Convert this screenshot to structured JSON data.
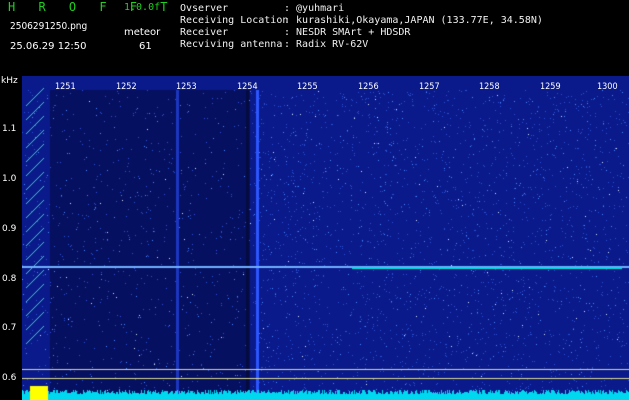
{
  "header": {
    "brand": "H R O F F T",
    "version": "1.0.0f",
    "filename": "2506291250.png",
    "datetime": "25.06.29 12:50",
    "meteor_label": "meteor",
    "meteor_count": "61"
  },
  "info": [
    {
      "key": "Ovserver",
      "value": ": @yuhmari"
    },
    {
      "key": "Receiving Location",
      "value": ": kurashiki,Okayama,JAPAN (133.77E, 34.58N)"
    },
    {
      "key": "Receiver",
      "value": ": NESDR SMArt + HDSDR"
    },
    {
      "key": "Recviving antenna",
      "value": ": Radix RV-62V"
    }
  ],
  "chart_data": {
    "type": "heatmap",
    "ylabel": "kHz",
    "y_ticks": [
      "1.1",
      "1.0",
      "0.9",
      "0.8",
      "0.7",
      "0.6"
    ],
    "x_ticks": [
      "1251",
      "1252",
      "1253",
      "1254",
      "1255",
      "1256",
      "1257",
      "1258",
      "1259",
      "1300"
    ],
    "colors": {
      "background": "#0a1a8a",
      "noise": "#3a6fff",
      "signal": "#00e0e0",
      "baseline": "#ffff00"
    }
  }
}
